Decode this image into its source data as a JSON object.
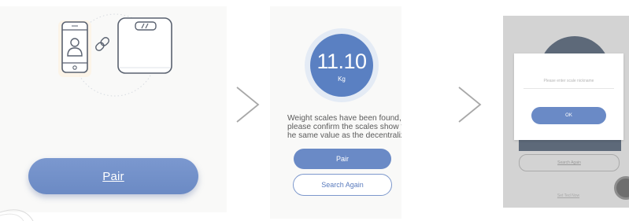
{
  "panel1": {
    "pair_label": "Pair"
  },
  "panel2": {
    "weight": "11.10",
    "unit": "Kg",
    "message": "Weight scales have been found,\nplease confirm the scales show t\nhe same value as the decentraliz",
    "pair_label": "Pair",
    "search_again_label": "Search Again"
  },
  "panel3": {
    "dialog": {
      "input_placeholder": "Please enter scale nickname",
      "ok_label": "OK"
    },
    "background": {
      "outline_button_label": "Search Again",
      "link_label": "Set Ted Now"
    }
  },
  "colors": {
    "accent": "#6a8ac6",
    "accent_dark": "#5a80c2",
    "panel_bg": "#f9f9f8",
    "overlay_bg": "#d3d3d3"
  },
  "icons": [
    "phone-icon",
    "user-icon",
    "link-icon",
    "scale-icon",
    "chevron-right-icon"
  ]
}
